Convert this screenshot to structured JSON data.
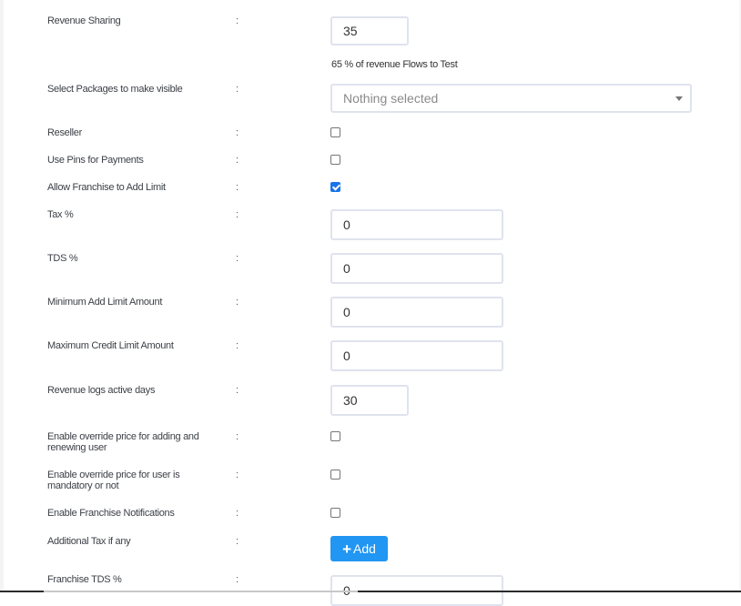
{
  "form": {
    "revenue_sharing": {
      "label": "Revenue Sharing",
      "value": "35",
      "hint": "65 % of revenue Flows to Test"
    },
    "packages": {
      "label": "Select Packages to make visible",
      "placeholder": "Nothing selected"
    },
    "reseller": {
      "label": "Reseller",
      "checked": false
    },
    "use_pins": {
      "label": "Use Pins for Payments",
      "checked": false
    },
    "allow_add_limit": {
      "label": "Allow Franchise to Add Limit",
      "checked": true
    },
    "tax": {
      "label": "Tax %",
      "value": "0"
    },
    "tds": {
      "label": "TDS %",
      "value": "0"
    },
    "min_add_limit": {
      "label": "Minimum Add Limit Amount",
      "value": "0"
    },
    "max_credit_limit": {
      "label": "Maximum Credit Limit Amount",
      "value": "0"
    },
    "revenue_logs_days": {
      "label": "Revenue logs active days",
      "value": "30"
    },
    "override_price_add_renew": {
      "label": "Enable override price for adding and renewing user",
      "checked": false
    },
    "override_price_mandatory": {
      "label": "Enable override price for user is mandatory or not",
      "checked": false
    },
    "franchise_notifications": {
      "label": "Enable Franchise Notifications",
      "checked": false
    },
    "additional_tax": {
      "label": "Additional Tax if any",
      "button_label": "Add",
      "button_icon": "plus-icon"
    },
    "franchise_tds": {
      "label": "Franchise TDS %",
      "value": "0"
    },
    "separator": ":"
  },
  "colors": {
    "accent": "#2196f3",
    "checkbox_checked": "#1a73e8",
    "input_border": "#dfe3ee"
  }
}
